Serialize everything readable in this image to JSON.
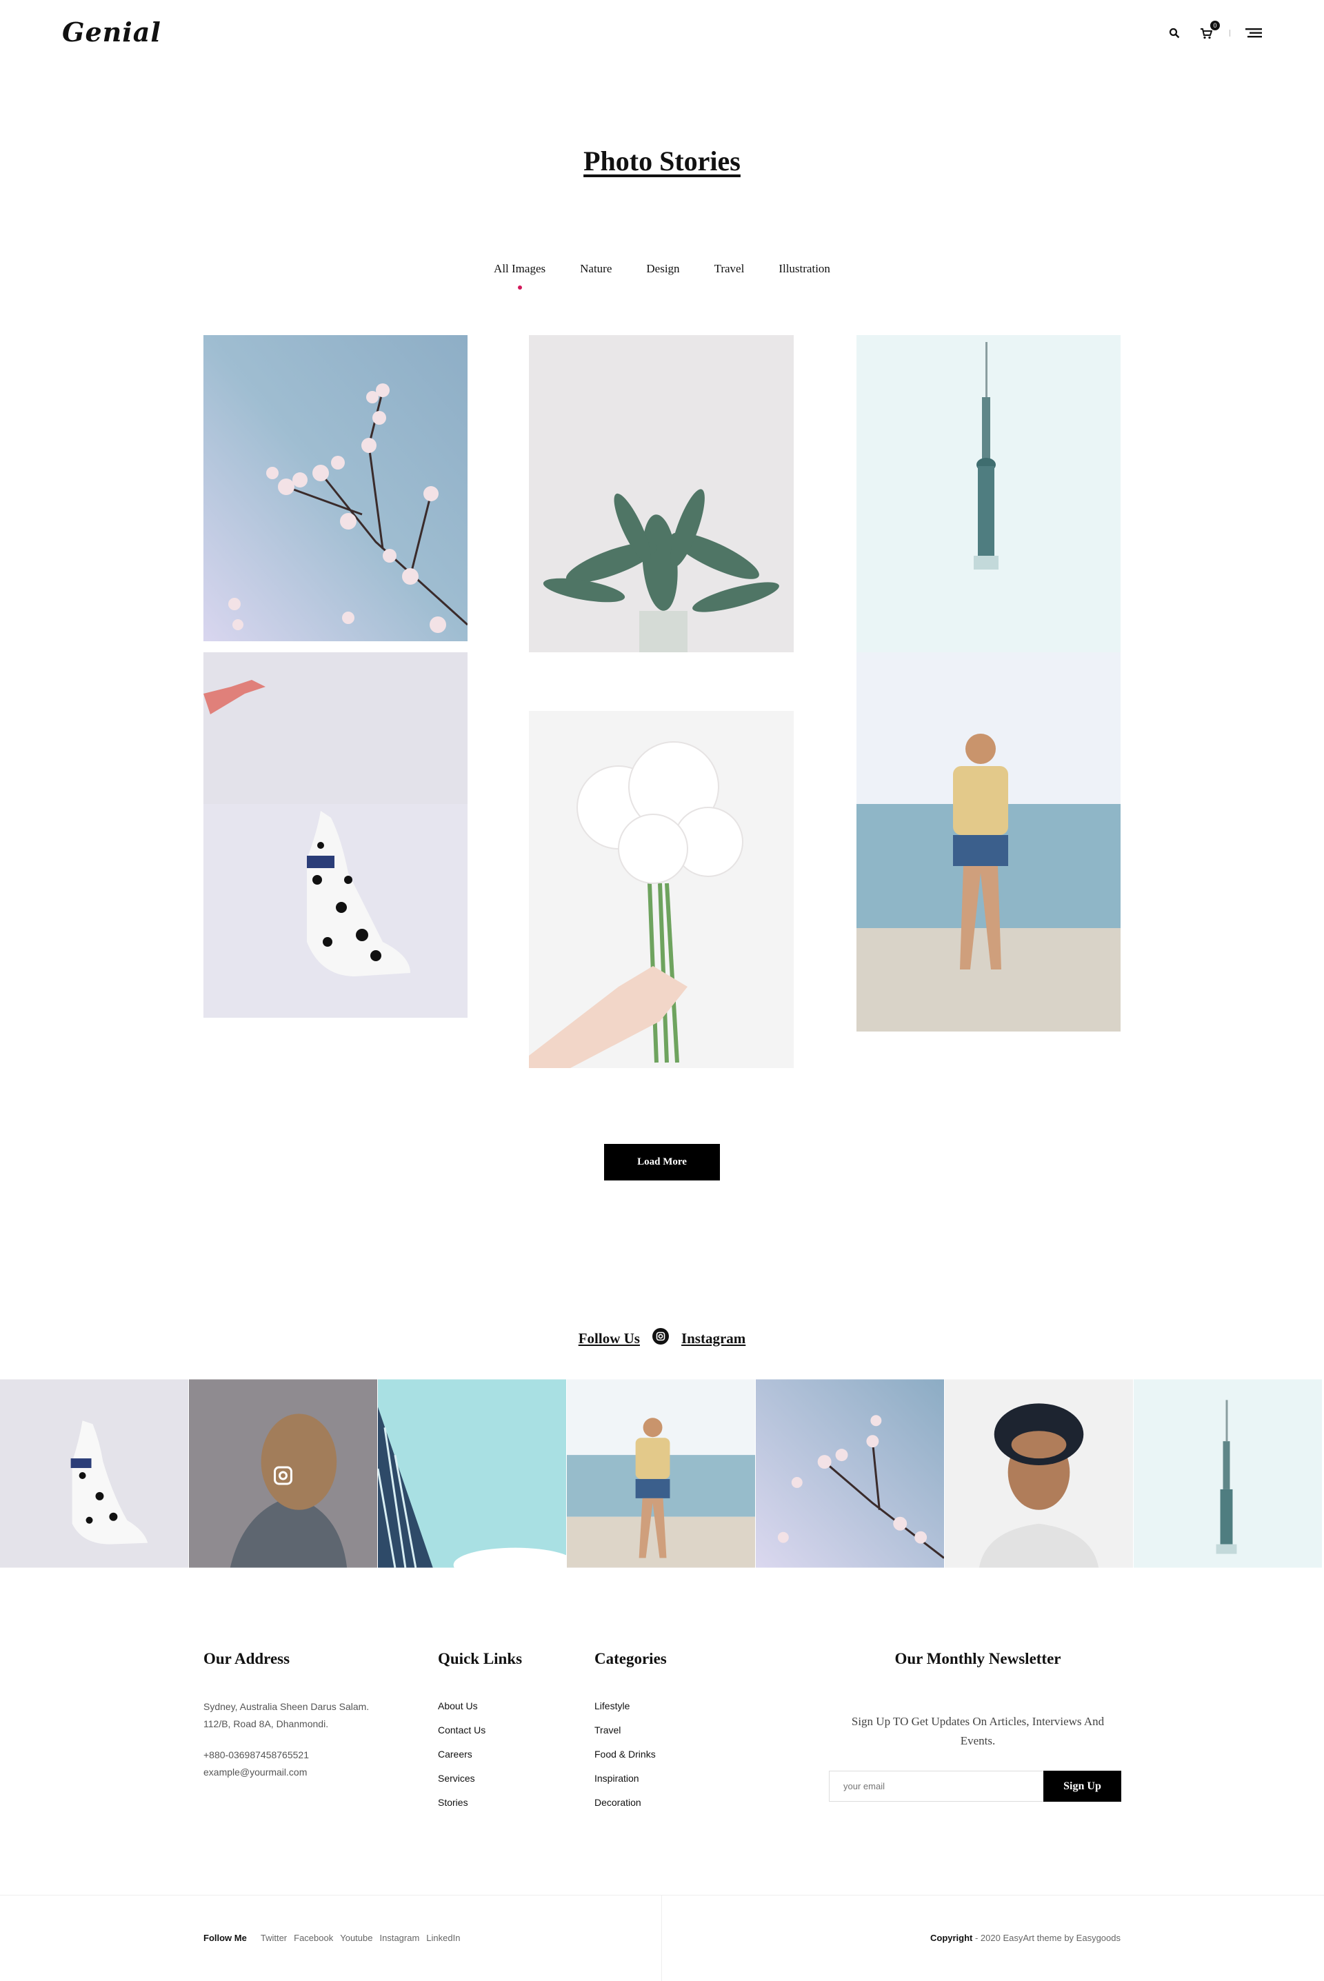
{
  "header": {
    "logo": "Genial",
    "cart_count": "0",
    "icons": [
      "search-icon",
      "cart-icon",
      "menu-icon"
    ]
  },
  "page_title": "Photo Stories",
  "filters": {
    "items": [
      "All Images",
      "Nature",
      "Design",
      "Travel",
      "Illustration"
    ],
    "active": "All Images",
    "active_color": "#d2195b"
  },
  "gallery": {
    "images": [
      "cherry-blossom-branch",
      "potted-eucalyptus",
      "tv-tower-in-fog",
      "dalmatian-dog",
      "white-peony-bouquet",
      "woman-on-beach"
    ]
  },
  "load_more": "Load More",
  "instagram": {
    "follow_label": "Follow Us",
    "network_label": "Instagram",
    "images": [
      "dalmatian-dog",
      "woman-hair-wind",
      "building-sky",
      "woman-on-beach",
      "cherry-blossom-branch",
      "man-in-hat",
      "tv-tower-in-fog"
    ]
  },
  "footer": {
    "address": {
      "title": "Our Address",
      "line1": "Sydney, Australia Sheen Darus Salam.",
      "line2": "112/B, Road 8A, Dhanmondi.",
      "phone": "+880-036987458765521",
      "email": "example@yourmail.com"
    },
    "quick_links": {
      "title": "Quick Links",
      "items": [
        "About Us",
        "Contact Us",
        "Careers",
        "Services",
        "Stories"
      ]
    },
    "categories": {
      "title": "Categories",
      "items": [
        "Lifestyle",
        "Travel",
        "Food & Drinks",
        "Inspiration",
        "Decoration"
      ]
    },
    "newsletter": {
      "title": "Our Monthly Newsletter",
      "text": "Sign Up TO Get Updates On Articles, Interviews And Events.",
      "placeholder": "your email",
      "button": "Sign Up"
    }
  },
  "bottom": {
    "follow_me": "Follow Me",
    "social": [
      "Twitter",
      "Facebook",
      "Youtube",
      "Instagram",
      "LinkedIn"
    ],
    "copyright_bold": "Copyright",
    "copyright_text": " - 2020 EasyArt theme by Easygoods"
  }
}
